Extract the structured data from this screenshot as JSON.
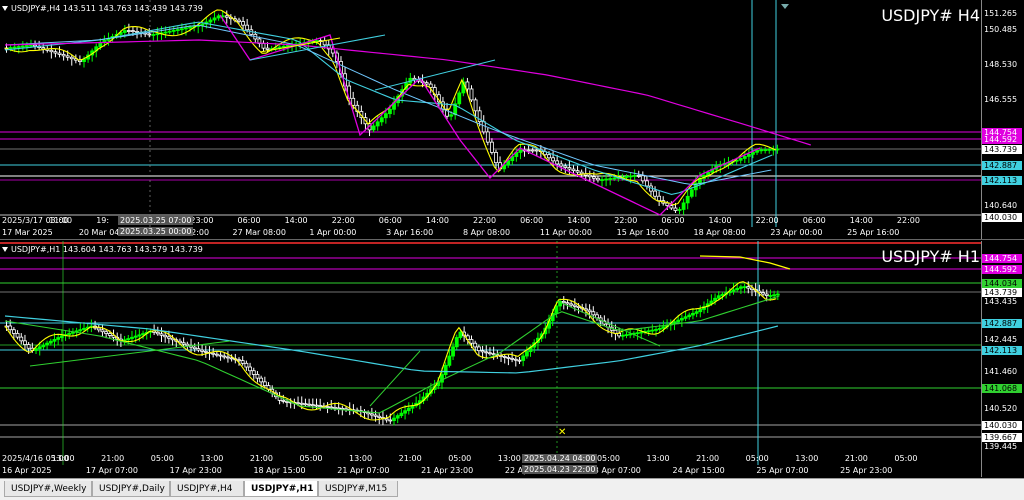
{
  "colors": {
    "bull": "#00ff00",
    "bear": "#ffffff",
    "yellow": "#ffff00",
    "cyan": "#40d0e0",
    "magenta": "#e000e0",
    "green": "#30d030",
    "line_yellow": "#ffff80"
  },
  "top": {
    "info": "USDJPY#,H4  143.511 143.763 143.439 143.739",
    "title": "USDJPY# H4",
    "prices": [
      "151.265",
      "150.485",
      "148.530",
      "146.555",
      "144.754",
      "144.592",
      "143.739",
      "142.887",
      "142.113",
      "140.640",
      "140.030"
    ],
    "time_ticks": [
      "2025/3/17 03:00",
      "11:00",
      "19:",
      "15:00",
      "23:00",
      "06:00",
      "14:00",
      "22:00",
      "06:00",
      "14:00",
      "22:00",
      "06:00",
      "14:00",
      "22:00",
      "06:00",
      "14:00",
      "22:00",
      "06:00",
      "14:00",
      "22:00"
    ],
    "date_ticks": [
      "17 Mar 2025",
      "20 Mar 04:00",
      "25 Mar 12:00",
      "27 Mar 08:00",
      "1 Apr 00:00",
      "3 Apr 16:00",
      "8 Apr 08:00",
      "11 Apr 00:00",
      "15 Apr 16:00",
      "18 Apr 08:00",
      "23 Apr 00:00",
      "25 Apr 16:00"
    ],
    "marker": "2025.03.25 07:00",
    "marker2": "2025.03.25 00:00"
  },
  "bottom": {
    "info": "USDJPY#,H1  143.604 143.763 143.579 143.739",
    "title": "USDJPY# H1",
    "prices": [
      "144.754",
      "144.592",
      "144.034",
      "143.739",
      "143.435",
      "142.887",
      "142.445",
      "142.113",
      "141.460",
      "141.068",
      "140.520",
      "140.030",
      "139.667",
      "139.445"
    ],
    "time_ticks": [
      "2025/4/16 05:00",
      "13:00",
      "21:00",
      "05:00",
      "13:00",
      "21:00",
      "05:00",
      "13:00",
      "21:00",
      "05:00",
      "13:00",
      "21:00",
      "05:00",
      "13:00",
      "21:00",
      "05:00",
      "13:00",
      "21:00",
      "05:00"
    ],
    "date_ticks": [
      "16 Apr 2025",
      "17 Apr 07:00",
      "17 Apr 23:00",
      "18 Apr 15:00",
      "21 Apr 07:00",
      "21 Apr 23:00",
      "22 Apr 15:00",
      "23 Apr 07:00",
      "24 Apr 15:00",
      "25 Apr 07:00",
      "25 Apr 23:00"
    ],
    "marker": "2025.04.24 04:00",
    "marker2": "2025.04.23 22:00"
  },
  "tabs": [
    "USDJPY#,Weekly",
    "USDJPY#,Daily",
    "USDJPY#,H4",
    "USDJPY#,H1",
    "USDJPY#,M15"
  ],
  "active_tab": "USDJPY#,H1"
}
